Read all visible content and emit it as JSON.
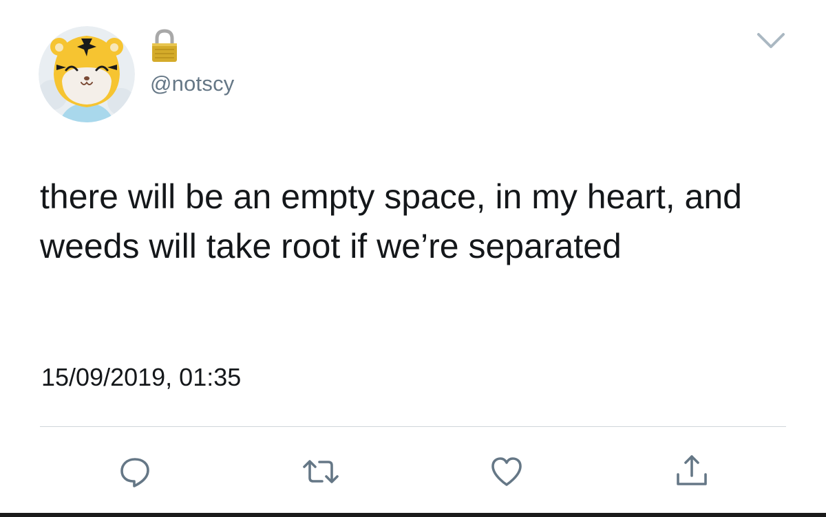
{
  "tweet": {
    "handle": "@notscy",
    "protected": true,
    "text": "there will be an empty space, in my heart, and weeds will take root if we’re separated",
    "timestamp": "15/09/2019, 01:35"
  },
  "icons": {
    "avatar": "tiger-cartoon-avatar",
    "lock": "lock-icon",
    "menu": "chevron-down-icon",
    "reply": "reply-icon",
    "retweet": "retweet-icon",
    "like": "heart-icon",
    "share": "share-icon"
  },
  "colors": {
    "text": "#14171a",
    "secondary": "#657786",
    "icon": "#657786",
    "divider": "#cfd5da",
    "lock_gold": "#c9a227"
  }
}
